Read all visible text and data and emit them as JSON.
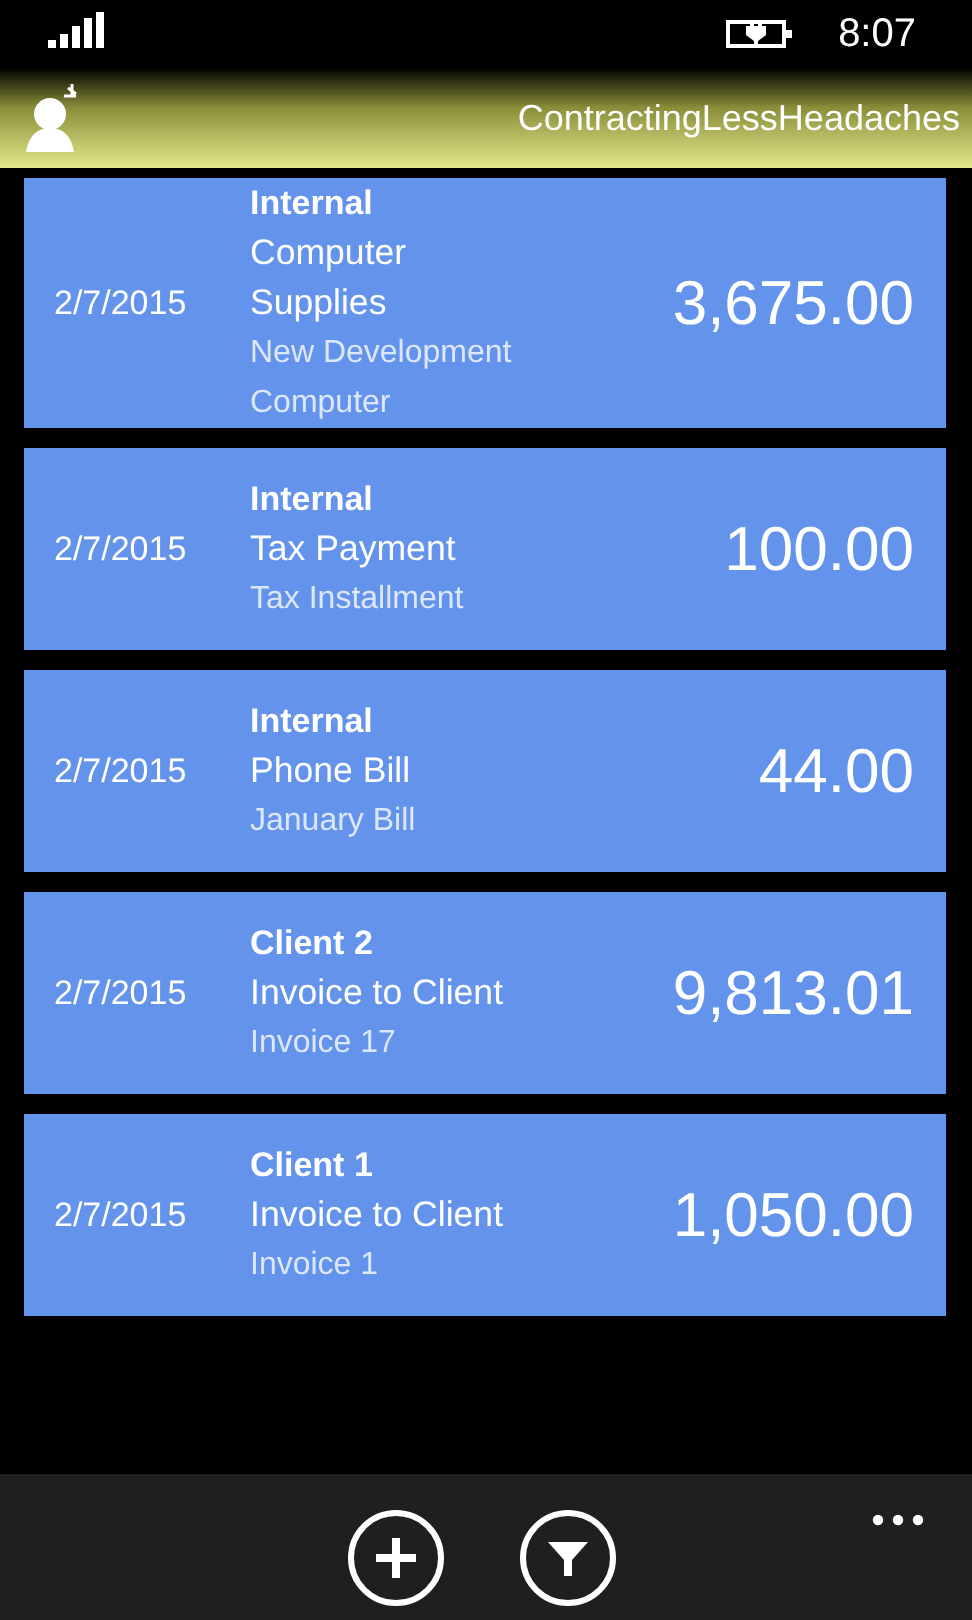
{
  "status_bar": {
    "time": "8:07"
  },
  "header": {
    "title": "ContractingLessHeadaches"
  },
  "transactions": [
    {
      "date": "2/7/2015",
      "party": "Internal",
      "category": "Computer Supplies",
      "description": "New Development Computer",
      "amount": "3,675.00"
    },
    {
      "date": "2/7/2015",
      "party": "Internal",
      "category": "Tax Payment",
      "description": "Tax Installment",
      "amount": "100.00"
    },
    {
      "date": "2/7/2015",
      "party": "Internal",
      "category": "Phone Bill",
      "description": "January Bill",
      "amount": "44.00"
    },
    {
      "date": "2/7/2015",
      "party": "Client 2",
      "category": "Invoice to Client",
      "description": "Invoice 17",
      "amount": "9,813.01"
    },
    {
      "date": "2/7/2015",
      "party": "Client 1",
      "category": "Invoice to Client",
      "description": "Invoice 1",
      "amount": "1,050.00"
    }
  ],
  "app_bar": {
    "buttons": [
      {
        "kind": "add"
      },
      {
        "kind": "filter"
      }
    ]
  }
}
